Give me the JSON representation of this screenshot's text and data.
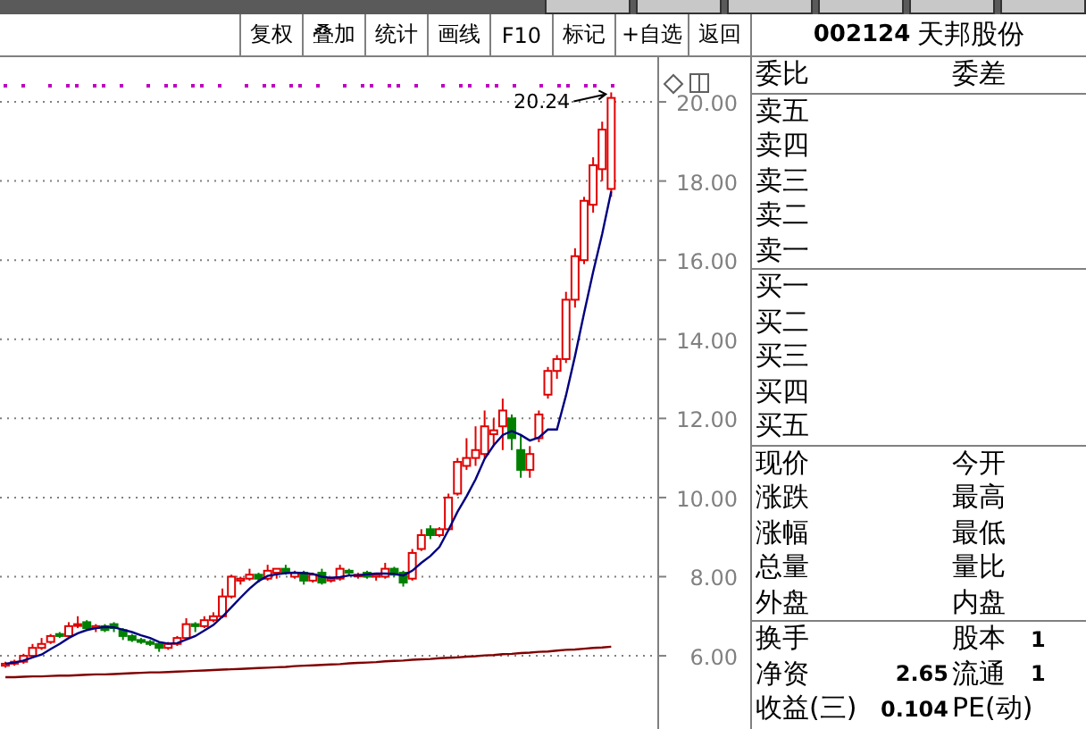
{
  "toolbar": {
    "buttons": [
      "复权",
      "叠加",
      "统计",
      "画线",
      "F10",
      "标记",
      "+自选",
      "返回"
    ]
  },
  "chart": {
    "chart_data": {
      "type": "candlestick",
      "grid": true,
      "ylim": [
        4.15,
        21.13
      ],
      "yticks": [
        {
          "value": 20,
          "label": "20.00"
        },
        {
          "value": 18,
          "label": "18.00"
        },
        {
          "value": 16,
          "label": "16.00"
        },
        {
          "value": 14,
          "label": "14.00"
        },
        {
          "value": 12,
          "label": "12.00"
        },
        {
          "value": 10,
          "label": "10.00"
        },
        {
          "value": 8,
          "label": "8.00"
        },
        {
          "value": 6,
          "label": "6.00"
        }
      ],
      "categories": [
        null,
        null,
        null,
        null,
        null,
        null,
        null,
        null,
        null,
        null,
        null,
        null,
        null,
        null,
        null,
        null,
        null,
        null,
        null,
        null,
        null,
        null,
        null,
        null,
        null,
        null,
        null,
        null,
        null,
        null,
        null,
        null,
        null,
        null,
        null,
        null,
        null,
        null,
        null,
        null,
        null,
        null,
        null,
        null,
        null,
        null,
        null,
        null,
        null,
        null,
        null,
        null,
        null,
        null,
        null,
        null,
        null,
        null,
        null,
        null,
        null,
        null,
        null,
        null,
        null,
        null,
        null,
        null
      ],
      "ohlc": [
        [
          5.75,
          5.85,
          5.7,
          5.8
        ],
        [
          5.8,
          5.9,
          5.75,
          5.85
        ],
        [
          5.85,
          6.05,
          5.8,
          6.0
        ],
        [
          6.0,
          6.3,
          5.95,
          6.2
        ],
        [
          6.2,
          6.45,
          6.15,
          6.3
        ],
        [
          6.35,
          6.55,
          6.3,
          6.5
        ],
        [
          6.55,
          6.6,
          6.45,
          6.5
        ],
        [
          6.5,
          6.85,
          6.45,
          6.75
        ],
        [
          6.8,
          7.0,
          6.7,
          6.8
        ],
        [
          6.85,
          6.9,
          6.65,
          6.7
        ],
        [
          6.7,
          6.8,
          6.6,
          6.75
        ],
        [
          6.75,
          6.8,
          6.6,
          6.65
        ],
        [
          6.8,
          6.85,
          6.6,
          6.7
        ],
        [
          6.65,
          6.7,
          6.4,
          6.5
        ],
        [
          6.5,
          6.55,
          6.35,
          6.4
        ],
        [
          6.4,
          6.45,
          6.3,
          6.35
        ],
        [
          6.35,
          6.4,
          6.25,
          6.3
        ],
        [
          6.3,
          6.35,
          6.1,
          6.2
        ],
        [
          6.2,
          6.35,
          6.15,
          6.3
        ],
        [
          6.3,
          6.5,
          6.25,
          6.45
        ],
        [
          6.45,
          6.95,
          6.4,
          6.8
        ],
        [
          6.8,
          6.85,
          6.6,
          6.75
        ],
        [
          6.75,
          7.0,
          6.7,
          6.9
        ],
        [
          6.9,
          7.1,
          6.85,
          7.0
        ],
        [
          7.0,
          7.7,
          6.95,
          7.5
        ],
        [
          7.5,
          8.05,
          7.45,
          8.0
        ],
        [
          7.9,
          8.0,
          7.8,
          7.95
        ],
        [
          7.95,
          8.2,
          7.9,
          8.05
        ],
        [
          8.05,
          8.1,
          7.85,
          7.95
        ],
        [
          7.95,
          8.3,
          7.9,
          8.15
        ],
        [
          8.1,
          8.2,
          7.95,
          8.2
        ],
        [
          8.2,
          8.3,
          8.05,
          8.1
        ],
        [
          8.0,
          8.15,
          7.95,
          8.1
        ],
        [
          8.1,
          8.15,
          7.8,
          7.9
        ],
        [
          7.9,
          8.1,
          7.85,
          8.05
        ],
        [
          8.1,
          8.2,
          7.8,
          7.85
        ],
        [
          7.9,
          8.0,
          7.85,
          7.95
        ],
        [
          7.95,
          8.3,
          7.9,
          8.2
        ],
        [
          8.15,
          8.2,
          8.05,
          8.1
        ],
        [
          8.05,
          8.1,
          7.95,
          8.05
        ],
        [
          8.1,
          8.15,
          7.95,
          8.0
        ],
        [
          8.0,
          8.1,
          7.9,
          8.05
        ],
        [
          8.0,
          8.35,
          7.95,
          8.2
        ],
        [
          8.2,
          8.25,
          8.0,
          8.05
        ],
        [
          8.1,
          8.15,
          7.75,
          7.85
        ],
        [
          7.95,
          8.7,
          7.9,
          8.6
        ],
        [
          8.7,
          9.2,
          8.65,
          9.05
        ],
        [
          9.2,
          9.3,
          8.95,
          9.05
        ],
        [
          9.05,
          9.25,
          9.0,
          9.2
        ],
        [
          9.2,
          10.1,
          9.15,
          10.0
        ],
        [
          10.1,
          11.0,
          10.05,
          10.9
        ],
        [
          10.8,
          11.5,
          10.7,
          11.0
        ],
        [
          11.0,
          11.8,
          10.8,
          11.2
        ],
        [
          11.1,
          12.2,
          11.0,
          11.8
        ],
        [
          11.6,
          12.0,
          11.3,
          11.7
        ],
        [
          11.8,
          12.5,
          11.2,
          12.2
        ],
        [
          12.0,
          12.1,
          11.2,
          11.5
        ],
        [
          11.2,
          11.6,
          10.5,
          10.7
        ],
        [
          10.7,
          11.3,
          10.5,
          11.1
        ],
        [
          11.5,
          12.2,
          11.4,
          12.1
        ],
        [
          12.6,
          13.3,
          12.5,
          13.2
        ],
        [
          13.2,
          13.6,
          13.0,
          13.5
        ],
        [
          13.5,
          15.2,
          13.4,
          15.0
        ],
        [
          15.0,
          16.3,
          14.8,
          16.1
        ],
        [
          16.0,
          17.6,
          15.9,
          17.5
        ],
        [
          17.4,
          18.6,
          17.2,
          18.4
        ],
        [
          18.3,
          19.5,
          18.0,
          19.3
        ],
        [
          17.8,
          20.24,
          17.6,
          20.1
        ]
      ],
      "series": [
        {
          "type": "line",
          "color": "#000080",
          "values": [
            5.8,
            5.83,
            5.88,
            5.96,
            6.03,
            6.17,
            6.3,
            6.45,
            6.57,
            6.65,
            6.7,
            6.73,
            6.72,
            6.66,
            6.6,
            6.52,
            6.45,
            6.35,
            6.31,
            6.32,
            6.41,
            6.5,
            6.64,
            6.78,
            6.99,
            7.23,
            7.47,
            7.7,
            7.89,
            8.02,
            8.06,
            8.09,
            8.1,
            8.09,
            8.07,
            8.0,
            7.97,
            7.99,
            8.03,
            8.03,
            8.06,
            8.08,
            8.08,
            8.07,
            8.03,
            8.15,
            8.35,
            8.52,
            8.75,
            9.18,
            9.64,
            10.03,
            10.46,
            10.98,
            11.32,
            11.58,
            11.68,
            11.58,
            11.44,
            11.52,
            11.72,
            11.72,
            12.58,
            13.58,
            14.66,
            15.7,
            16.66,
            17.74
          ]
        },
        {
          "type": "line",
          "color": "#800000",
          "values": [
            5.46,
            5.46,
            5.47,
            5.48,
            5.48,
            5.49,
            5.5,
            5.5,
            5.51,
            5.52,
            5.53,
            5.53,
            5.54,
            5.55,
            5.56,
            5.57,
            5.58,
            5.58,
            5.59,
            5.6,
            5.61,
            5.62,
            5.63,
            5.64,
            5.65,
            5.66,
            5.67,
            5.68,
            5.69,
            5.7,
            5.71,
            5.72,
            5.74,
            5.75,
            5.76,
            5.77,
            5.78,
            5.79,
            5.81,
            5.82,
            5.83,
            5.84,
            5.86,
            5.87,
            5.88,
            5.9,
            5.91,
            5.92,
            5.94,
            5.95,
            5.96,
            5.98,
            5.99,
            6.01,
            6.02,
            6.04,
            6.05,
            6.07,
            6.08,
            6.1,
            6.11,
            6.13,
            6.15,
            6.16,
            6.18,
            6.2,
            6.21,
            6.23
          ]
        }
      ],
      "annotations": [
        "20.24"
      ]
    }
  },
  "quote_panel": {
    "code": "002124",
    "name": "天邦股份",
    "header": [
      "委比",
      "委差"
    ],
    "sell": [
      "卖五",
      "卖四",
      "卖三",
      "卖二",
      "卖一"
    ],
    "buy": [
      "买一",
      "买二",
      "买三",
      "买四",
      "买五"
    ],
    "stats": [
      [
        "现价",
        "今开"
      ],
      [
        "涨跌",
        "最高"
      ],
      [
        "涨幅",
        "最低"
      ],
      [
        "总量",
        "量比"
      ],
      [
        "外盘",
        "内盘"
      ]
    ],
    "fundamentals": [
      {
        "left": {
          "label": "换手"
        },
        "right": {
          "label": "股本",
          "value": "1"
        }
      },
      {
        "left": {
          "label": "净资",
          "value": "2.65"
        },
        "right": {
          "label": "流通",
          "value": "1"
        }
      },
      {
        "left": {
          "label": "收益(三)",
          "value": "0.104"
        },
        "right": {
          "label": "PE(动)"
        }
      }
    ]
  }
}
